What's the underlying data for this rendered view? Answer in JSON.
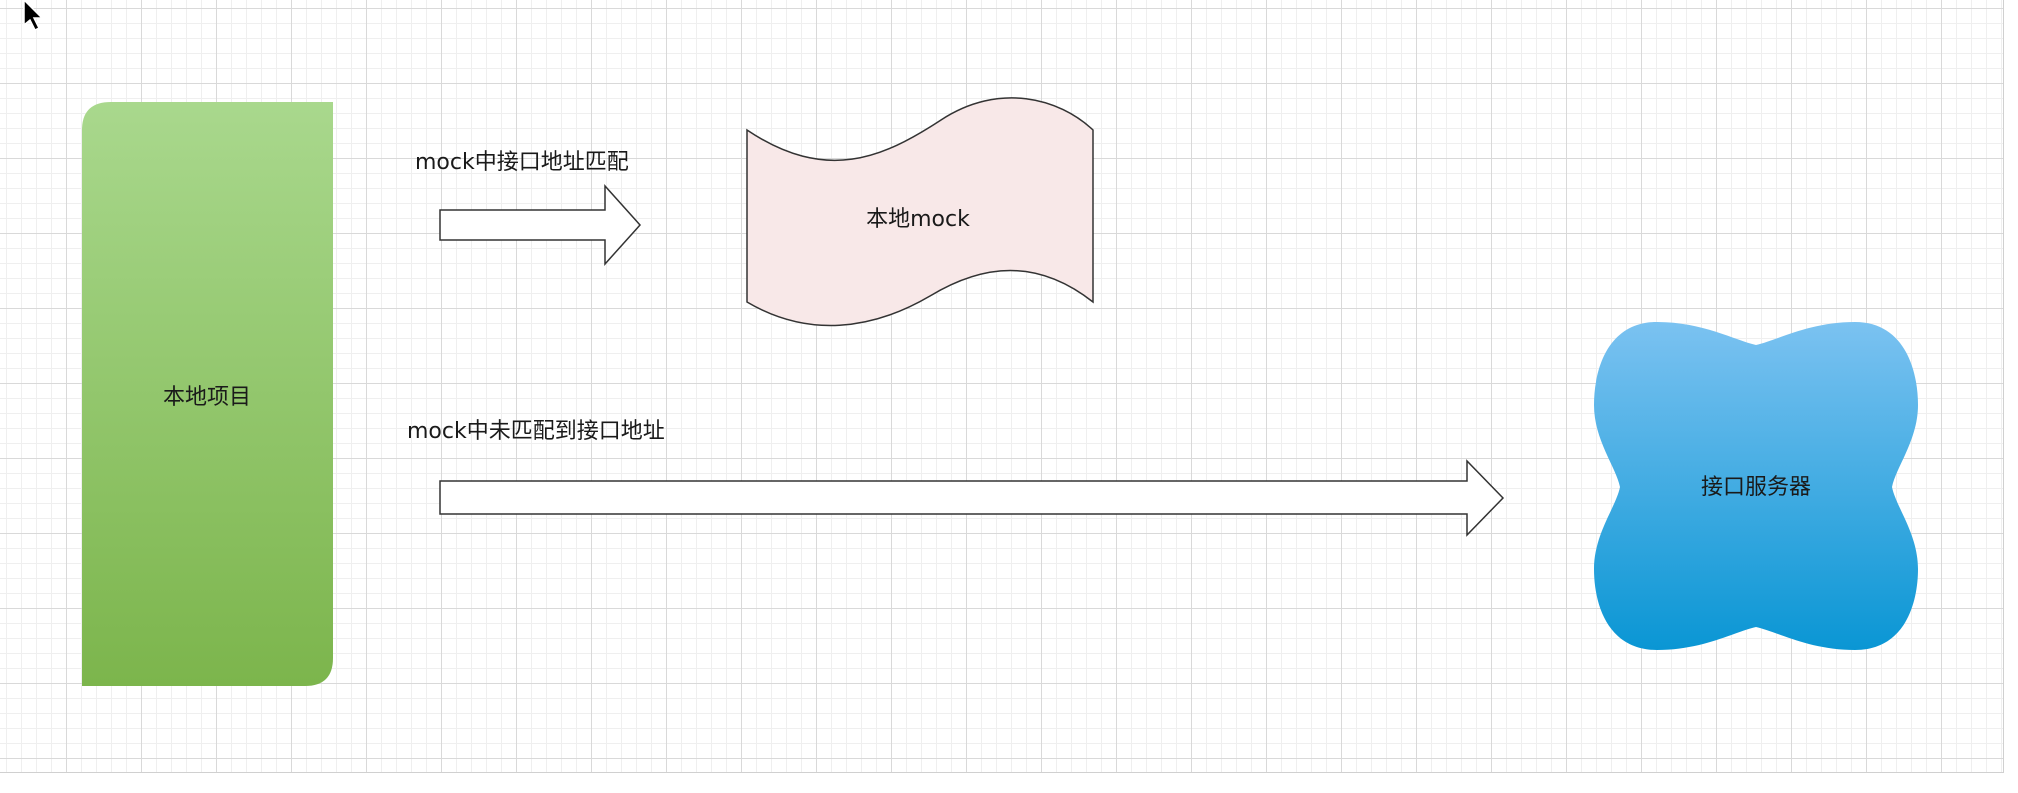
{
  "nodes": {
    "local_project": {
      "label": "本地项目",
      "color_top": "#a9d88d",
      "color_bottom": "#7cb54c"
    },
    "local_mock": {
      "label": "本地mock",
      "fill": "#f8e8e8"
    },
    "api_server": {
      "label": "接口服务器",
      "color_top": "#7bc2f1",
      "color_bottom": "#0a96d4"
    }
  },
  "edges": {
    "matched": {
      "label": "mock中接口地址匹配"
    },
    "unmatched": {
      "label": "mock中未匹配到接口地址"
    }
  },
  "cursor": {
    "icon": "mouse-pointer-icon"
  }
}
